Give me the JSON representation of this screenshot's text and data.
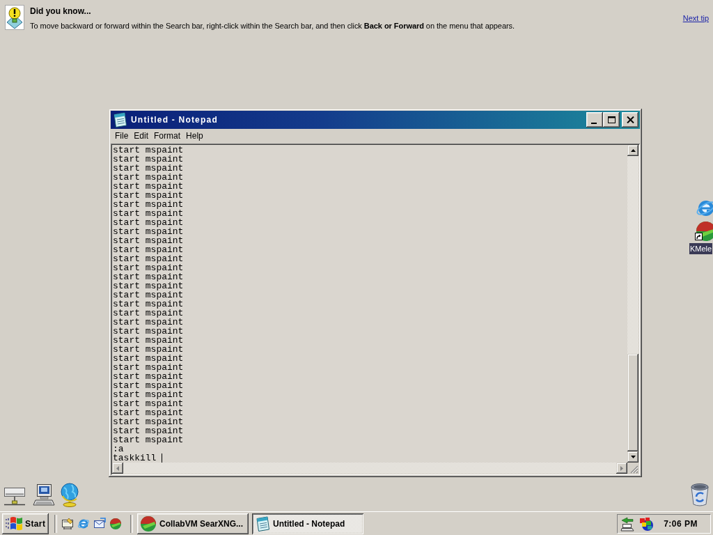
{
  "tip": {
    "heading": "Did you know...",
    "text": "To move backward or forward within the Search bar, right-click within the Search bar, and then click **Back or Forward** on the menu that appears.",
    "link": "Next tip"
  },
  "notepad": {
    "title": "Untitled - Notepad",
    "menu": [
      "File",
      "Edit",
      "Format",
      "Help"
    ],
    "lines": [
      "start mspaint",
      "start mspaint",
      "start mspaint",
      "start mspaint",
      "start mspaint",
      "start mspaint",
      "start mspaint",
      "start mspaint",
      "start mspaint",
      "start mspaint",
      "start mspaint",
      "start mspaint",
      "start mspaint",
      "start mspaint",
      "start mspaint",
      "start mspaint",
      "start mspaint",
      "start mspaint",
      "start mspaint",
      "start mspaint",
      "start mspaint",
      "start mspaint",
      "start mspaint",
      "start mspaint",
      "start mspaint",
      "start mspaint",
      "start mspaint",
      "start mspaint",
      "start mspaint",
      "start mspaint",
      "start mspaint",
      "start mspaint",
      "start mspaint",
      ":a",
      "taskkill"
    ]
  },
  "desktop_icons": [
    {
      "label": "KMele",
      "selected": true
    }
  ],
  "taskbar": {
    "start": "Start",
    "tasks": [
      {
        "label": "CollabVM SearXNG...",
        "selected": false
      },
      {
        "label": "Untitled - Notepad",
        "selected": true
      }
    ],
    "clock": "7:06 PM"
  }
}
